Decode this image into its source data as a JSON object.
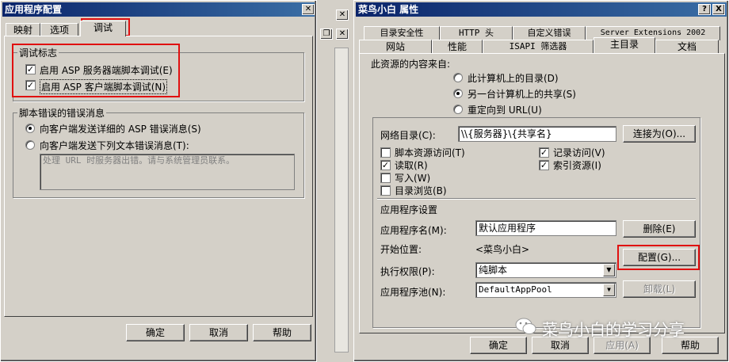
{
  "left_dialog": {
    "title": "应用程序配置",
    "tabs": [
      "映射",
      "选项",
      "调试"
    ],
    "debug_group": {
      "label": "调试标志",
      "options": [
        {
          "label": "启用 ASP 服务器端脚本调试(E)",
          "checked": true
        },
        {
          "label": "启用 ASP 客户端脚本调试(N)",
          "checked": true
        }
      ]
    },
    "script_error_group": {
      "label": "脚本错误的错误消息",
      "option1": "向客户端发送详细的 ASP 错误消息(S)",
      "option2": "向客户端发送下列文本错误消息(T):",
      "error_text": "处理 URL 时服务器出错。请与系统管理员联系。"
    },
    "buttons": {
      "ok": "确定",
      "cancel": "取消",
      "help": "帮助"
    }
  },
  "right_dialog": {
    "title": "菜鸟小白 属性",
    "title_buttons": {
      "help": "?",
      "close": "X"
    },
    "tabs_back": [
      "目录安全性",
      "HTTP 头",
      "自定义错误",
      "Server Extensions 2002"
    ],
    "tabs_front": [
      "网站",
      "性能",
      "ISAPI 筛选器",
      "主目录",
      "文档"
    ],
    "content_source": {
      "label": "此资源的内容来自:",
      "options": [
        "此计算机上的目录(D)",
        "另一台计算机上的共享(S)",
        "重定向到 URL(U)"
      ],
      "selected": 1
    },
    "network_dir": {
      "label": "网络目录(C):",
      "value": "\\\\{服务器}\\{共享名}",
      "connect_button": "连接为(O)..."
    },
    "permissions_left": [
      {
        "label": "脚本资源访问(T)",
        "checked": false
      },
      {
        "label": "读取(R)",
        "checked": true
      },
      {
        "label": "写入(W)",
        "checked": false
      },
      {
        "label": "目录浏览(B)",
        "checked": false
      }
    ],
    "permissions_right": [
      {
        "label": "记录访问(V)",
        "checked": true
      },
      {
        "label": "索引资源(I)",
        "checked": true
      }
    ],
    "app_settings": {
      "label": "应用程序设置",
      "app_name_label": "应用程序名(M):",
      "app_name_value": "默认应用程序",
      "remove_button": "删除(E)",
      "start_label": "开始位置:",
      "start_value": "<菜鸟小白>",
      "config_button": "配置(G)...",
      "exec_label": "执行权限(P):",
      "exec_value": "纯脚本",
      "pool_label": "应用程序池(N):",
      "pool_value": "DefaultAppPool",
      "unload_button": "卸载(L)"
    },
    "buttons": {
      "ok": "确定",
      "cancel": "取消",
      "apply": "应用(A)",
      "help": "帮助"
    }
  },
  "watermark": "菜鸟小白的学习分享",
  "colors": {
    "highlight": "#e01010",
    "titlebar": "#0a246a",
    "face": "#d4d0c8"
  }
}
